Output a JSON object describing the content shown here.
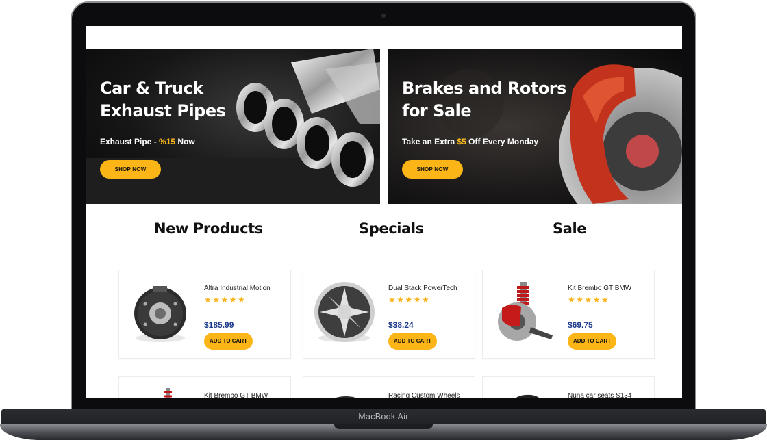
{
  "device": {
    "label": "MacBook Air"
  },
  "banners": [
    {
      "title": "Car & Truck\nExhaust Pipes",
      "sub_prefix": "Exhaust Pipe - ",
      "sub_highlight": "%15",
      "sub_suffix": " Now",
      "button": "SHOP NOW"
    },
    {
      "title": "Brakes and Rotors\nfor Sale",
      "sub_prefix": "Take an Extra ",
      "sub_highlight": "$5",
      "sub_suffix": " Off Every Monday",
      "button": "SHOP NOW"
    }
  ],
  "tabs": [
    "New Products",
    "Specials",
    "Sale"
  ],
  "products": [
    {
      "name": "Altra Industrial Motion",
      "stars": "★★★★★",
      "price": "$185.99",
      "button": "ADD TO CART",
      "icon": "clutch-motor-icon"
    },
    {
      "name": "Dual Stack PowerTech",
      "stars": "★★★★★",
      "price": "$38.24",
      "button": "ADD TO CART",
      "icon": "chrome-wheel-icon"
    },
    {
      "name": "Kit Brembo GT BMW",
      "stars": "★★★★★",
      "price": "$69.75",
      "button": "ADD TO CART",
      "icon": "brake-suspension-icon"
    }
  ],
  "products_row2": [
    {
      "name": "Kit Brembo GT BMW"
    },
    {
      "name": "Racing Custom Wheels"
    },
    {
      "name": "Nuna car seats S134"
    }
  ],
  "colors": {
    "accent": "#fbb516",
    "price": "#1d3a8c",
    "banner_bg": "#111111"
  }
}
